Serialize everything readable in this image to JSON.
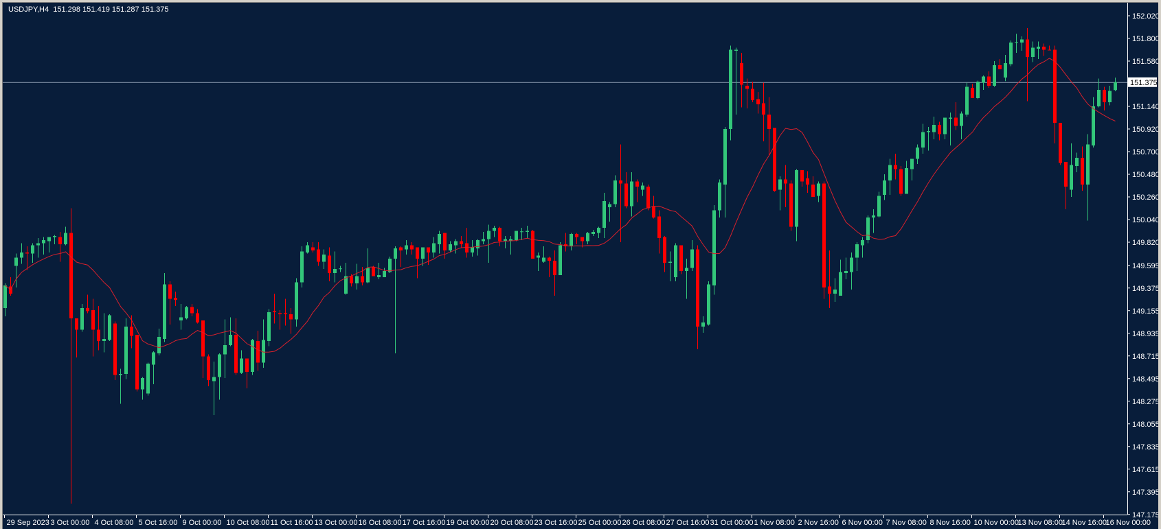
{
  "header": {
    "symbol": "USDJPY,H4",
    "open": "151.298",
    "high": "151.419",
    "low": "151.287",
    "close": "151.375"
  },
  "colors": {
    "background": "#081d3a",
    "bull": "#33c77a",
    "bear": "#ff0000",
    "ma": "#d8202c",
    "axis": "#ffffff",
    "price_line": "#8fa0b4"
  },
  "chart_data": {
    "type": "candlestick",
    "title": "USDJPY,H4",
    "ylim": [
      147.175,
      152.02
    ],
    "y_ticks": [
      "152.020",
      "151.800",
      "151.580",
      "151.140",
      "150.920",
      "150.700",
      "150.480",
      "150.260",
      "150.040",
      "149.820",
      "149.595",
      "149.375",
      "149.155",
      "148.935",
      "148.715",
      "148.495",
      "148.275",
      "148.055",
      "147.835",
      "147.615",
      "147.395",
      "147.175"
    ],
    "current_price": "151.375",
    "x_ticks": [
      "29 Sep 2023",
      "3 Oct 00:00",
      "4 Oct 08:00",
      "5 Oct 16:00",
      "9 Oct 00:00",
      "10 Oct 08:00",
      "11 Oct 16:00",
      "13 Oct 00:00",
      "16 Oct 08:00",
      "17 Oct 16:00",
      "19 Oct 00:00",
      "20 Oct 08:00",
      "23 Oct 16:00",
      "25 Oct 00:00",
      "26 Oct 08:00",
      "27 Oct 16:00",
      "31 Oct 00:00",
      "1 Nov 08:00",
      "2 Nov 16:00",
      "6 Nov 00:00",
      "7 Nov 08:00",
      "8 Nov 16:00",
      "10 Nov 00:00",
      "13 Nov 08:00",
      "14 Nov 16:00",
      "16 Nov 00:00"
    ],
    "x_tick_every_bars": 8,
    "ma_period": 14,
    "ohlc_fields": [
      "open",
      "high",
      "low",
      "close"
    ],
    "ohlc": [
      [
        149.18,
        149.42,
        149.1,
        149.4
      ],
      [
        149.39,
        149.48,
        149.3,
        149.32
      ],
      [
        149.59,
        149.71,
        149.38,
        149.67
      ],
      [
        149.67,
        149.81,
        149.61,
        149.72
      ],
      [
        149.72,
        149.78,
        149.55,
        149.71
      ],
      [
        149.71,
        149.81,
        149.62,
        149.79
      ],
      [
        149.79,
        149.86,
        149.67,
        149.81
      ],
      [
        149.81,
        149.87,
        149.7,
        149.84
      ],
      [
        149.83,
        149.87,
        149.72,
        149.87
      ],
      [
        149.87,
        149.89,
        149.8,
        149.88
      ],
      [
        149.87,
        149.92,
        149.63,
        149.8
      ],
      [
        149.8,
        149.97,
        149.79,
        149.91
      ],
      [
        149.91,
        150.15,
        147.28,
        149.08
      ],
      [
        149.08,
        149.08,
        148.7,
        148.97
      ],
      [
        148.97,
        149.22,
        148.95,
        149.18
      ],
      [
        149.18,
        149.31,
        149.13,
        149.15
      ],
      [
        149.16,
        149.27,
        148.71,
        148.97
      ],
      [
        148.97,
        149.2,
        148.77,
        148.86
      ],
      [
        148.86,
        149.13,
        148.75,
        148.88
      ],
      [
        148.87,
        149.12,
        148.86,
        149.11
      ],
      [
        149.03,
        149.05,
        148.48,
        148.53
      ],
      [
        148.53,
        148.59,
        148.25,
        148.54
      ],
      [
        148.54,
        149.08,
        148.49,
        149.0
      ],
      [
        149.0,
        149.11,
        148.79,
        148.91
      ],
      [
        148.92,
        148.92,
        148.37,
        148.39
      ],
      [
        148.39,
        148.51,
        148.29,
        148.5
      ],
      [
        148.35,
        148.65,
        148.33,
        148.64
      ],
      [
        148.63,
        148.76,
        148.44,
        148.75
      ],
      [
        148.74,
        148.98,
        148.72,
        148.9
      ],
      [
        148.88,
        149.52,
        148.85,
        149.41
      ],
      [
        149.41,
        149.44,
        149.02,
        149.27
      ],
      [
        149.28,
        149.34,
        149.2,
        149.26
      ],
      [
        149.06,
        149.22,
        148.97,
        149.09
      ],
      [
        149.08,
        149.2,
        149.07,
        149.19
      ],
      [
        149.19,
        149.22,
        149.1,
        149.13
      ],
      [
        149.13,
        149.17,
        149.03,
        149.04
      ],
      [
        149.06,
        149.06,
        148.5,
        148.71
      ],
      [
        148.71,
        148.73,
        148.42,
        148.48
      ],
      [
        148.47,
        148.66,
        148.14,
        148.51
      ],
      [
        148.51,
        148.74,
        148.29,
        148.73
      ],
      [
        148.73,
        149.07,
        148.5,
        148.82
      ],
      [
        148.82,
        149.09,
        148.81,
        148.92
      ],
      [
        148.92,
        149.08,
        148.53,
        148.55
      ],
      [
        148.55,
        148.77,
        148.54,
        148.69
      ],
      [
        148.69,
        148.69,
        148.4,
        148.56
      ],
      [
        148.56,
        148.88,
        148.53,
        148.87
      ],
      [
        148.86,
        148.96,
        148.57,
        148.65
      ],
      [
        148.65,
        149.07,
        148.6,
        148.87
      ],
      [
        148.86,
        149.17,
        148.81,
        149.14
      ],
      [
        149.15,
        149.32,
        149.03,
        149.14
      ],
      [
        149.13,
        149.16,
        148.97,
        149.12
      ],
      [
        149.13,
        149.27,
        149.01,
        149.12
      ],
      [
        149.12,
        149.18,
        148.93,
        149.07
      ],
      [
        149.07,
        149.47,
        149.0,
        149.43
      ],
      [
        149.43,
        149.78,
        149.38,
        149.73
      ],
      [
        149.72,
        149.82,
        149.71,
        149.79
      ],
      [
        149.77,
        149.82,
        149.72,
        149.74
      ],
      [
        149.75,
        149.82,
        149.59,
        149.63
      ],
      [
        149.63,
        149.75,
        149.56,
        149.7
      ],
      [
        149.69,
        149.77,
        149.44,
        149.52
      ],
      [
        149.52,
        149.73,
        149.43,
        149.56
      ],
      [
        149.56,
        149.59,
        149.53,
        149.565
      ],
      [
        149.32,
        149.62,
        149.31,
        149.49
      ],
      [
        149.49,
        149.51,
        149.39,
        149.42
      ],
      [
        149.42,
        149.61,
        149.36,
        149.49
      ],
      [
        149.49,
        149.58,
        149.4,
        149.43
      ],
      [
        149.43,
        149.76,
        149.42,
        149.57
      ],
      [
        149.58,
        149.59,
        149.49,
        149.49
      ],
      [
        149.48,
        149.62,
        149.46,
        149.5
      ],
      [
        149.48,
        149.57,
        149.48,
        149.54
      ],
      [
        149.53,
        149.68,
        149.52,
        149.66
      ],
      [
        149.66,
        149.78,
        148.74,
        149.76
      ],
      [
        149.77,
        149.78,
        149.58,
        149.74
      ],
      [
        149.75,
        149.84,
        149.7,
        149.79
      ],
      [
        149.79,
        149.82,
        149.7,
        149.75
      ],
      [
        149.77,
        149.77,
        149.47,
        149.66
      ],
      [
        149.66,
        149.77,
        149.59,
        149.77
      ],
      [
        149.77,
        149.77,
        149.6,
        149.72
      ],
      [
        149.72,
        149.87,
        149.67,
        149.81
      ],
      [
        149.8,
        149.93,
        149.71,
        149.9
      ],
      [
        149.91,
        149.91,
        149.66,
        149.74
      ],
      [
        149.74,
        149.83,
        149.72,
        149.8
      ],
      [
        149.79,
        149.85,
        149.71,
        149.83
      ],
      [
        149.83,
        149.88,
        149.77,
        149.8
      ],
      [
        149.81,
        149.96,
        149.67,
        149.72
      ],
      [
        149.72,
        149.84,
        149.68,
        149.77
      ],
      [
        149.76,
        149.85,
        149.69,
        149.84
      ],
      [
        149.83,
        149.92,
        149.8,
        149.85
      ],
      [
        149.85,
        149.99,
        149.62,
        149.93
      ],
      [
        149.93,
        149.98,
        149.87,
        149.96
      ],
      [
        149.96,
        149.97,
        149.78,
        149.83
      ],
      [
        149.83,
        149.88,
        149.76,
        149.85
      ],
      [
        149.83,
        149.88,
        149.7,
        149.85
      ],
      [
        149.84,
        149.93,
        149.83,
        149.93
      ],
      [
        149.92,
        149.96,
        149.84,
        149.925
      ],
      [
        149.92,
        149.98,
        149.86,
        149.93
      ],
      [
        149.93,
        149.94,
        149.66,
        149.66
      ],
      [
        149.67,
        149.72,
        149.54,
        149.69
      ],
      [
        149.63,
        149.78,
        149.62,
        149.67
      ],
      [
        149.67,
        149.68,
        149.48,
        149.64
      ],
      [
        149.64,
        149.74,
        149.3,
        149.5
      ],
      [
        149.5,
        149.82,
        149.5,
        149.79
      ],
      [
        149.8,
        149.91,
        149.73,
        149.78
      ],
      [
        149.78,
        149.91,
        149.74,
        149.9
      ],
      [
        149.9,
        149.91,
        149.8,
        149.87
      ],
      [
        149.87,
        149.87,
        149.77,
        149.83
      ],
      [
        149.83,
        149.92,
        149.8,
        149.91
      ],
      [
        149.9,
        149.94,
        149.88,
        149.92
      ],
      [
        149.91,
        149.97,
        149.86,
        149.96
      ],
      [
        149.96,
        150.3,
        149.86,
        150.22
      ],
      [
        150.16,
        150.21,
        150.02,
        150.19
      ],
      [
        150.19,
        150.47,
        150.16,
        150.42
      ],
      [
        150.42,
        150.77,
        149.82,
        150.39
      ],
      [
        150.39,
        150.5,
        150.15,
        150.17
      ],
      [
        150.17,
        150.5,
        150.07,
        150.41
      ],
      [
        150.41,
        150.43,
        150.21,
        150.36
      ],
      [
        150.33,
        150.4,
        150.27,
        150.37
      ],
      [
        150.36,
        150.38,
        150.13,
        150.15
      ],
      [
        150.17,
        150.27,
        150.05,
        150.06
      ],
      [
        150.07,
        150.13,
        149.71,
        149.86
      ],
      [
        149.87,
        149.88,
        149.53,
        149.62
      ],
      [
        149.62,
        149.73,
        149.44,
        149.63
      ],
      [
        149.48,
        149.81,
        149.44,
        149.79
      ],
      [
        149.79,
        149.79,
        149.51,
        149.54
      ],
      [
        149.54,
        149.66,
        149.27,
        149.57
      ],
      [
        149.57,
        149.84,
        149.54,
        149.75
      ],
      [
        149.75,
        149.79,
        148.78,
        149.0
      ],
      [
        149.0,
        149.1,
        148.94,
        149.04
      ],
      [
        149.02,
        149.44,
        149.01,
        149.41
      ],
      [
        149.4,
        150.18,
        149.31,
        150.13
      ],
      [
        150.13,
        150.43,
        150.06,
        150.4
      ],
      [
        150.38,
        150.94,
        150.06,
        150.92
      ],
      [
        150.92,
        151.73,
        150.81,
        151.69
      ],
      [
        151.68,
        151.71,
        151.06,
        151.69
      ],
      [
        151.56,
        151.66,
        151.13,
        151.35
      ],
      [
        151.34,
        151.41,
        151.12,
        151.31
      ],
      [
        151.31,
        151.38,
        151.18,
        151.2
      ],
      [
        151.21,
        151.28,
        151.07,
        151.16
      ],
      [
        151.17,
        151.37,
        150.8,
        151.06
      ],
      [
        151.06,
        151.23,
        150.66,
        150.92
      ],
      [
        150.93,
        150.93,
        150.31,
        150.32
      ],
      [
        150.33,
        150.46,
        150.13,
        150.43
      ],
      [
        150.43,
        150.57,
        150.16,
        150.39
      ],
      [
        150.39,
        150.42,
        149.93,
        149.97
      ],
      [
        149.97,
        150.53,
        149.83,
        150.52
      ],
      [
        150.52,
        150.52,
        150.36,
        150.41
      ],
      [
        150.44,
        150.51,
        150.3,
        150.38
      ],
      [
        150.38,
        150.46,
        150.26,
        150.26
      ],
      [
        150.27,
        150.41,
        150.21,
        150.39
      ],
      [
        150.39,
        150.41,
        149.27,
        149.38
      ],
      [
        149.39,
        149.74,
        149.18,
        149.32
      ],
      [
        149.32,
        149.47,
        149.24,
        149.36
      ],
      [
        149.3,
        149.65,
        149.3,
        149.53
      ],
      [
        149.52,
        149.67,
        149.46,
        149.54
      ],
      [
        149.53,
        149.72,
        149.36,
        149.67
      ],
      [
        149.67,
        149.82,
        149.54,
        149.8
      ],
      [
        149.79,
        149.87,
        149.67,
        149.84
      ],
      [
        149.84,
        150.08,
        149.81,
        150.06
      ],
      [
        150.06,
        150.14,
        149.91,
        150.08
      ],
      [
        150.07,
        150.31,
        150.06,
        150.27
      ],
      [
        150.28,
        150.48,
        150.23,
        150.42
      ],
      [
        150.42,
        150.63,
        150.28,
        150.57
      ],
      [
        150.57,
        150.68,
        150.43,
        150.53
      ],
      [
        150.53,
        150.56,
        150.27,
        150.29
      ],
      [
        150.29,
        150.61,
        150.29,
        150.54
      ],
      [
        150.53,
        150.63,
        150.42,
        150.63
      ],
      [
        150.63,
        150.77,
        150.58,
        150.74
      ],
      [
        150.74,
        150.97,
        150.68,
        150.89
      ],
      [
        150.89,
        150.94,
        150.71,
        150.9
      ],
      [
        150.89,
        151.04,
        150.82,
        150.96
      ],
      [
        150.96,
        150.99,
        150.81,
        150.87
      ],
      [
        150.87,
        151.03,
        150.82,
        151.03
      ],
      [
        151.02,
        151.08,
        150.76,
        151.03
      ],
      [
        151.03,
        151.18,
        150.91,
        150.95
      ],
      [
        150.95,
        151.09,
        150.82,
        151.07
      ],
      [
        151.06,
        151.37,
        151.04,
        151.33
      ],
      [
        151.32,
        151.36,
        151.22,
        151.22
      ],
      [
        151.22,
        151.39,
        151.21,
        151.38
      ],
      [
        151.37,
        151.44,
        151.3,
        151.43
      ],
      [
        151.43,
        151.48,
        151.32,
        151.34
      ],
      [
        151.34,
        151.58,
        151.33,
        151.54
      ],
      [
        151.54,
        151.6,
        151.5,
        151.5
      ],
      [
        151.42,
        151.64,
        151.385,
        151.56
      ],
      [
        151.55,
        151.78,
        151.53,
        151.76
      ],
      [
        151.76,
        151.845,
        151.66,
        151.765
      ],
      [
        151.76,
        151.82,
        151.68,
        151.79
      ],
      [
        151.79,
        151.9,
        151.19,
        151.62
      ],
      [
        151.62,
        151.77,
        151.57,
        151.71
      ],
      [
        151.7,
        151.77,
        151.6,
        151.72
      ],
      [
        151.72,
        151.75,
        151.63,
        151.69
      ],
      [
        151.69,
        151.73,
        151.69,
        151.685
      ],
      [
        151.69,
        151.73,
        150.78,
        150.98
      ],
      [
        150.98,
        150.98,
        150.57,
        150.59
      ],
      [
        150.6,
        150.6,
        150.14,
        150.36
      ],
      [
        150.33,
        150.78,
        150.26,
        150.57
      ],
      [
        150.56,
        150.69,
        150.5,
        150.64
      ],
      [
        150.64,
        150.75,
        150.32,
        150.38
      ],
      [
        150.38,
        150.87,
        150.03,
        150.77
      ],
      [
        150.76,
        151.23,
        150.74,
        151.14
      ],
      [
        151.14,
        151.41,
        151.13,
        151.3
      ],
      [
        151.3,
        151.33,
        151.1,
        151.18
      ],
      [
        151.18,
        151.34,
        151.15,
        151.29
      ],
      [
        151.298,
        151.419,
        151.287,
        151.375
      ]
    ]
  }
}
